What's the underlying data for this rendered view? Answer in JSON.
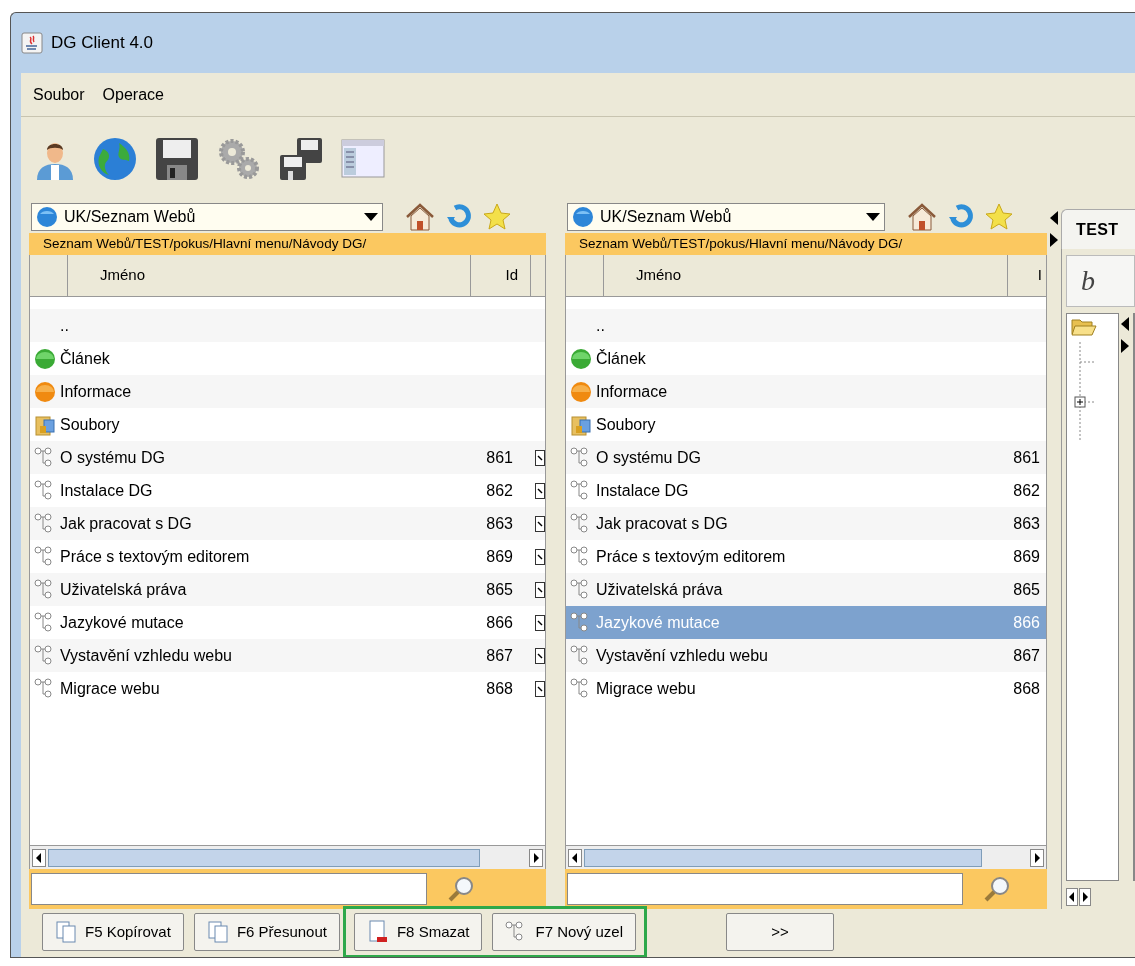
{
  "window": {
    "title": "DG Client 4.0"
  },
  "menu": [
    "Soubor",
    "Operace"
  ],
  "panels": [
    {
      "location": "UK/Seznam Webů",
      "path": "Seznam Webů/TEST/pokus/Hlavní menu/Návody DG/",
      "columns": [
        "Jméno",
        "Id"
      ],
      "marker_column": true,
      "rows": [
        {
          "kind": "parent",
          "name": "..",
          "selected": false
        },
        {
          "kind": "article",
          "name": "Článek",
          "selected": false
        },
        {
          "kind": "info",
          "name": "Informace",
          "selected": false
        },
        {
          "kind": "files",
          "name": "Soubory",
          "selected": false
        },
        {
          "kind": "node",
          "name": "O systému DG",
          "id": "861",
          "selected": false
        },
        {
          "kind": "node",
          "name": "Instalace DG",
          "id": "862",
          "selected": false
        },
        {
          "kind": "node",
          "name": "Jak pracovat s DG",
          "id": "863",
          "selected": false
        },
        {
          "kind": "node",
          "name": "Práce s textovým editorem",
          "id": "869",
          "selected": false
        },
        {
          "kind": "node",
          "name": "Uživatelská práva",
          "id": "865",
          "selected": false
        },
        {
          "kind": "node",
          "name": "Jazykové mutace",
          "id": "866",
          "selected": false
        },
        {
          "kind": "node",
          "name": "Vystavění vzhledu webu",
          "id": "867",
          "selected": false
        },
        {
          "kind": "node",
          "name": "Migrace webu",
          "id": "868",
          "selected": false
        }
      ]
    },
    {
      "location": "UK/Seznam Webů",
      "path": "Seznam Webů/TEST/pokus/Hlavní menu/Návody DG/",
      "columns": [
        "Jméno",
        "I"
      ],
      "marker_column": false,
      "rows": [
        {
          "kind": "parent",
          "name": "..",
          "selected": false
        },
        {
          "kind": "article",
          "name": "Článek",
          "selected": false
        },
        {
          "kind": "info",
          "name": "Informace",
          "selected": false
        },
        {
          "kind": "files",
          "name": "Soubory",
          "selected": false
        },
        {
          "kind": "node",
          "name": "O systému DG",
          "id": "861",
          "selected": false
        },
        {
          "kind": "node",
          "name": "Instalace DG",
          "id": "862",
          "selected": false
        },
        {
          "kind": "node",
          "name": "Jak pracovat s DG",
          "id": "863",
          "selected": false
        },
        {
          "kind": "node",
          "name": "Práce s textovým editorem",
          "id": "869",
          "selected": false
        },
        {
          "kind": "node",
          "name": "Uživatelská práva",
          "id": "865",
          "selected": false
        },
        {
          "kind": "node",
          "name": "Jazykové mutace",
          "id": "866",
          "selected": true
        },
        {
          "kind": "node",
          "name": "Vystavění vzhledu webu",
          "id": "867",
          "selected": false
        },
        {
          "kind": "node",
          "name": "Migrace webu",
          "id": "868",
          "selected": false
        }
      ]
    }
  ],
  "right_panel": {
    "tab": "TEST",
    "format_button": "b"
  },
  "button_groups": [
    {
      "highlighted": false,
      "buttons": [
        {
          "kind": "copy",
          "label": "F5 Kopírovat"
        },
        {
          "kind": "copy",
          "label": "F6 Přesunout"
        }
      ]
    },
    {
      "highlighted": true,
      "buttons": [
        {
          "kind": "delete",
          "label": "F8 Smazat"
        },
        {
          "kind": "node",
          "label": "F7 Nový uzel"
        }
      ]
    },
    {
      "highlighted": false,
      "buttons": [
        {
          "kind": "plain",
          "label": ">>"
        }
      ]
    }
  ]
}
